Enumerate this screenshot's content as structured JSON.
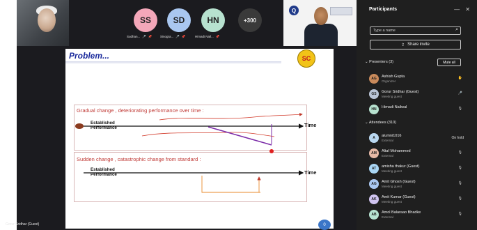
{
  "meeting": {
    "participants_tiles": [
      {
        "initials": "SS",
        "name": "Sudhan...",
        "color": "#f4a7b9"
      },
      {
        "initials": "SD",
        "name": "Sinogra...",
        "color": "#a9c7f0"
      },
      {
        "initials": "HN",
        "name": "Himadi Nail...",
        "color": "#b7e2cf"
      }
    ],
    "more_count": "+300",
    "self_view_name": "Gorur Sridhar (Guest)",
    "slide_number": "0"
  },
  "slide": {
    "title": "Problem...",
    "logo_text": "SC",
    "heading1": "Gradual change , deteriorating performance over time :",
    "heading2": "Sudden change , catastrophic change from standard :",
    "label_line1": "Established",
    "label_line2": "Performance",
    "axis_label": "Time"
  },
  "side": {
    "title": "Participants",
    "search_placeholder": "Type a name",
    "share_invite": "Share invite",
    "presenters_header": "Presenters (3)",
    "mute_all": "Mute all",
    "attendees_header": "Attendees (310)",
    "presenters": [
      {
        "initials": "AG",
        "name": "Ashish Gupta",
        "role": "Organizer",
        "color": "#c98a5b",
        "icon": "hand-raise-icon"
      },
      {
        "initials": "GS",
        "name": "Gorur Sridhar (Guest)",
        "role": "Meeting guest",
        "color": "#b9c4d6",
        "icon": "mic-icon"
      },
      {
        "initials": "HN",
        "name": "Himadi Nailwal",
        "role": "",
        "color": "#b7e2cf",
        "icon": "mic-off-icon"
      }
    ],
    "attendees": [
      {
        "initials": "A",
        "name": "alumni1016",
        "role": "External",
        "color": "#b9d7ef",
        "status": "On hold"
      },
      {
        "initials": "AM",
        "name": "Altaf Mohammed",
        "role": "External",
        "color": "#e6b9a6",
        "status": ""
      },
      {
        "initials": "AT",
        "name": "amisha thakur (Guest)",
        "role": "Meeting guest",
        "color": "#a9d6f5",
        "status": ""
      },
      {
        "initials": "AG",
        "name": "Amit Ghosh (Guest)",
        "role": "Meeting guest",
        "color": "#a9c7f0",
        "status": ""
      },
      {
        "initials": "AK",
        "name": "Amit Kumar (Guest)",
        "role": "Meeting guest",
        "color": "#cfc3ef",
        "status": ""
      },
      {
        "initials": "AB",
        "name": "Amol Balaraao Bhadke",
        "role": "External",
        "color": "#b6e3d1",
        "status": ""
      }
    ]
  }
}
